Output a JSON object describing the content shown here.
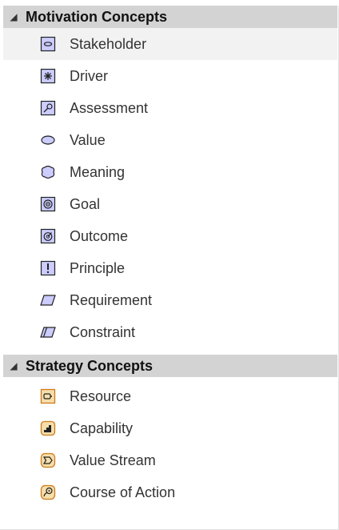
{
  "sections": [
    {
      "title": "Motivation Concepts",
      "items": [
        {
          "label": "Stakeholder",
          "icon": "stakeholder-icon"
        },
        {
          "label": "Driver",
          "icon": "driver-icon"
        },
        {
          "label": "Assessment",
          "icon": "assessment-icon"
        },
        {
          "label": "Value",
          "icon": "value-icon"
        },
        {
          "label": "Meaning",
          "icon": "meaning-icon"
        },
        {
          "label": "Goal",
          "icon": "goal-icon"
        },
        {
          "label": "Outcome",
          "icon": "outcome-icon"
        },
        {
          "label": "Principle",
          "icon": "principle-icon"
        },
        {
          "label": "Requirement",
          "icon": "requirement-icon"
        },
        {
          "label": "Constraint",
          "icon": "constraint-icon"
        }
      ]
    },
    {
      "title": "Strategy Concepts",
      "items": [
        {
          "label": "Resource",
          "icon": "resource-icon"
        },
        {
          "label": "Capability",
          "icon": "capability-icon"
        },
        {
          "label": "Value Stream",
          "icon": "value-stream-icon"
        },
        {
          "label": "Course of Action",
          "icon": "course-of-action-icon"
        }
      ]
    }
  ],
  "colors": {
    "header_bg": "#d3d3d3",
    "motivation_fill": "#ccccff",
    "strategy_fill": "#f5deaa",
    "strategy_border": "#d07a1a",
    "selected_bg": "#f2f2f2"
  }
}
